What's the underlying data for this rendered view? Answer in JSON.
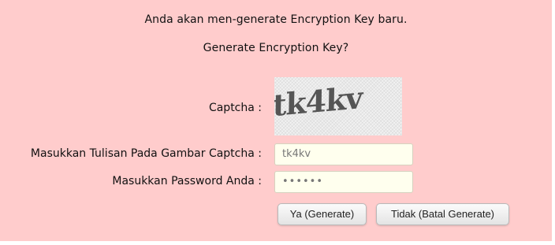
{
  "message": {
    "line1": "Anda akan men-generate Encryption Key baru.",
    "line2": "Generate Encryption Key?"
  },
  "captcha": {
    "label": "Captcha :",
    "image_text": "tk4kv"
  },
  "captcha_input": {
    "label": "Masukkan Tulisan Pada Gambar Captcha :",
    "value": "tk4kv"
  },
  "password_input": {
    "label": "Masukkan Password Anda :",
    "value": "••••••"
  },
  "buttons": {
    "confirm_label": "Ya (Generate)",
    "cancel_label": "Tidak (Batal Generate)"
  },
  "colors": {
    "panel_background": "#ffcccc",
    "input_background": "#ffffee"
  }
}
